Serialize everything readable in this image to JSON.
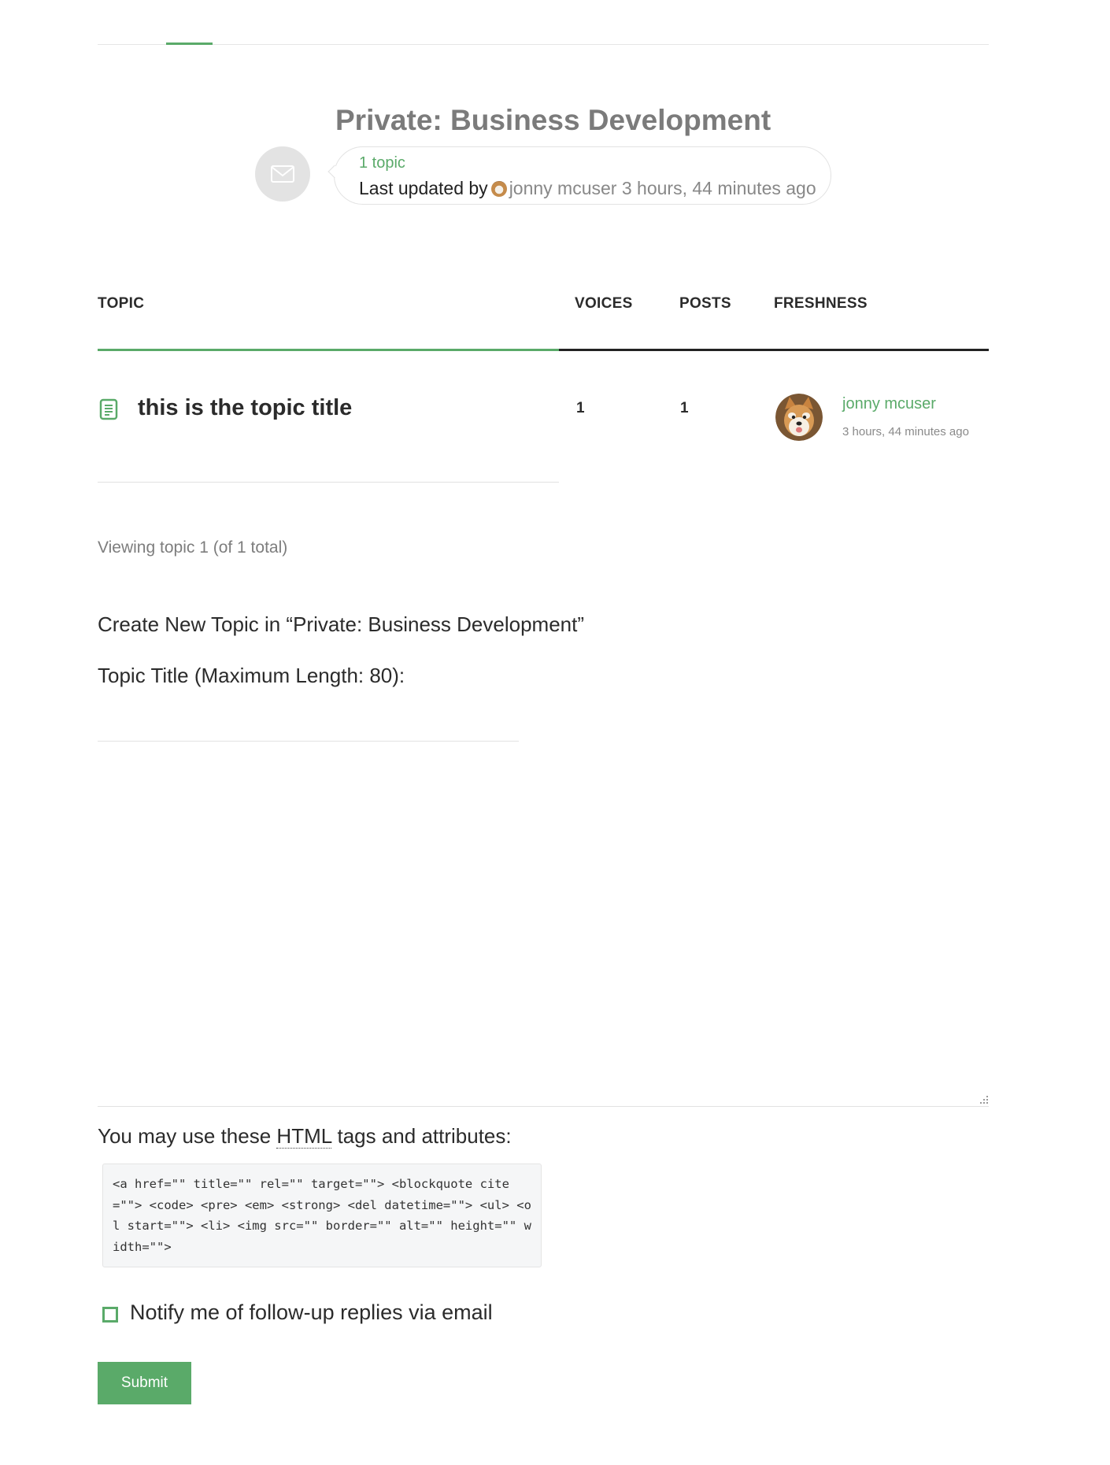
{
  "forum": {
    "title": "Private: Business Development",
    "topic_count": "1 topic",
    "last_updated_prefix": "Last updated by",
    "last_updated_user": "jonny mcuser",
    "last_updated_time": "3 hours, 44 minutes ago"
  },
  "table": {
    "headers": {
      "topic": "TOPIC",
      "voices": "VOICES",
      "posts": "POSTS",
      "freshness": "FRESHNESS"
    },
    "rows": [
      {
        "title": "this is the topic title",
        "voices": "1",
        "posts": "1",
        "freshness_user": "jonny mcuser",
        "freshness_time": "3 hours, 44 minutes ago"
      }
    ]
  },
  "pagination": {
    "count": "Viewing topic 1 (of 1 total)"
  },
  "form": {
    "legend": "Create New Topic in “Private: Business Development”",
    "title_label": "Topic Title (Maximum Length: 80):",
    "title_value": "",
    "content_value": "",
    "allowed_tags_prefix": "You may use these",
    "allowed_tags_abbr": "HTML",
    "allowed_tags_suffix": "tags and attributes:",
    "allowed_tags_code": "<a href=\"\" title=\"\" rel=\"\" target=\"\"> <blockquote cite=\"\"> <code> <pre> <em> <strong> <del datetime=\"\"> <ul> <ol start=\"\"> <li> <img src=\"\" border=\"\" alt=\"\" height=\"\" width=\"\">",
    "notify_label": "Notify me of follow-up replies via email",
    "notify_checked": false,
    "submit_label": "Submit"
  },
  "icons": {
    "forum_avatar": "envelope-icon",
    "topic": "document-icon",
    "resize": "resize-grip-icon"
  },
  "colors": {
    "accent": "#5aaa69",
    "muted_text": "#7b7b7b",
    "text": "#2b2b2b"
  }
}
